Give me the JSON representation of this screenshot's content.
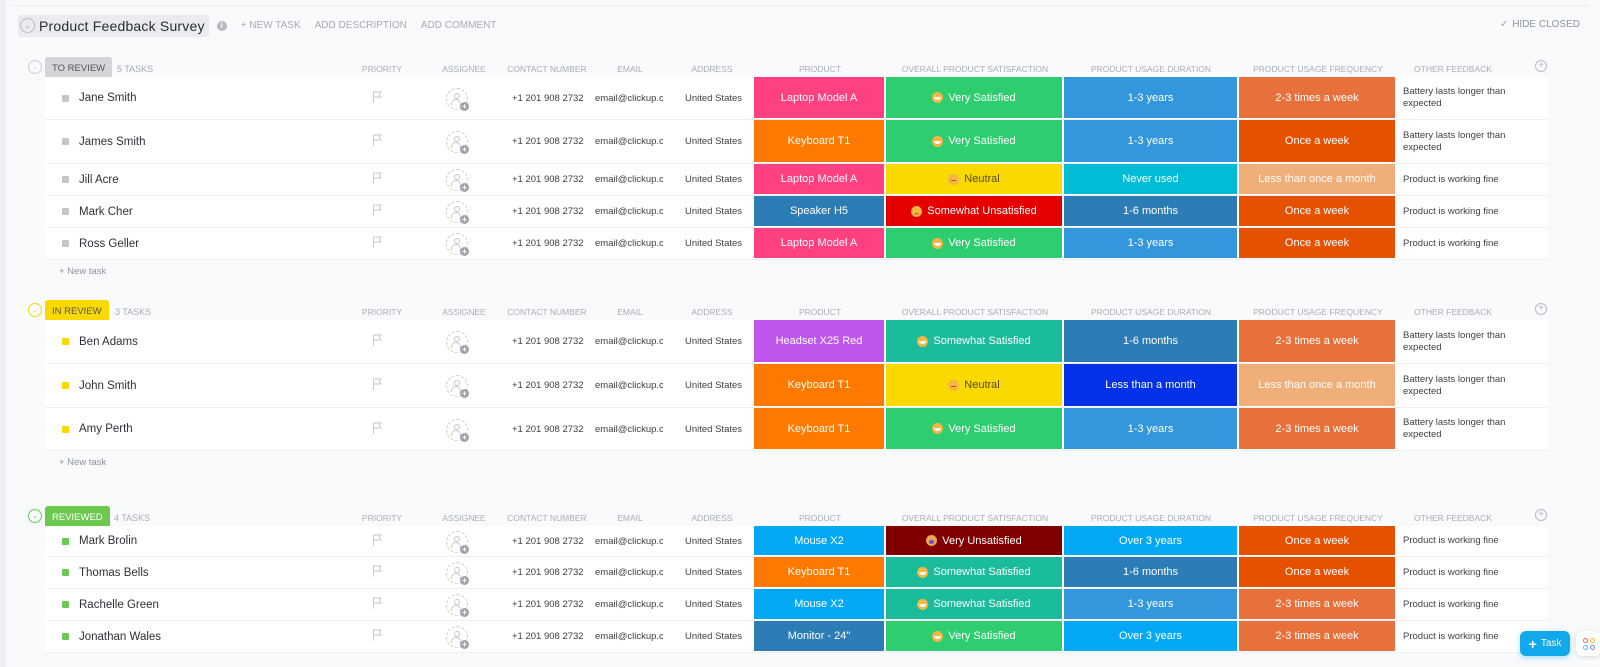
{
  "header": {
    "title": "Product Feedback Survey",
    "actions": [
      "+ NEW TASK",
      "ADD DESCRIPTION",
      "ADD COMMENT"
    ],
    "hide_closed": "HIDE CLOSED"
  },
  "columns": [
    "PRIORITY",
    "ASSIGNEE",
    "CONTACT NUMBER",
    "EMAIL",
    "ADDRESS",
    "PRODUCT",
    "OVERALL PRODUCT SATISFACTION",
    "PRODUCT USAGE DURATION",
    "PRODUCT USAGE FREQUENCY",
    "OTHER FEEDBACK"
  ],
  "new_task_label": "+ New task",
  "fab": {
    "task_label": "Task"
  },
  "colors": {
    "to_review": "#d3d5d9",
    "in_review": "#f9d900",
    "reviewed": "#6bc950",
    "product": {
      "Laptop Model A": "#ff4081",
      "Keyboard T1": "#ff7800",
      "Speaker H5": "#2c7cb5",
      "Headset X25 Red": "#bf55ec",
      "Mouse X2": "#03a9f4",
      "Monitor - 24\"": "#2c7cb5"
    },
    "satisfaction": {
      "Very Satisfied": "#2ecd6f",
      "Neutral": "#f9d900",
      "Somewhat Unsatisfied": "#e50000",
      "Somewhat Satisfied": "#1bbc9c",
      "Very Unsatisfied": "#800000"
    },
    "duration": {
      "1-3 years": "#3397dd",
      "Never used": "#00bcd4",
      "1-6 months": "#2c7cb5",
      "Less than a month": "#0231e8",
      "Over 3 years": "#03a9f4"
    },
    "frequency": {
      "2-3 times a week": "#e8703a",
      "Once a week": "#e65100",
      "Less than once a month": "#f0ae78"
    }
  },
  "groups": [
    {
      "status": "TO REVIEW",
      "count_label": "5 TASKS",
      "tasks": [
        {
          "name": "Jane Smith",
          "phone": "+1 201 908 2732",
          "email": "email@clickup.cc",
          "address": "United States",
          "product": "Laptop Model A",
          "satisfaction": "Very Satisfied",
          "duration": "1-3 years",
          "frequency": "2-3 times a week",
          "feedback": "Battery lasts longer than expected"
        },
        {
          "name": "James Smith",
          "phone": "+1 201 908 2732",
          "email": "email@clickup.cc",
          "address": "United States",
          "product": "Keyboard T1",
          "satisfaction": "Very Satisfied",
          "duration": "1-3 years",
          "frequency": "Once a week",
          "feedback": "Battery lasts longer than expected"
        },
        {
          "name": "Jill Acre",
          "phone": "+1 201 908 2732",
          "email": "email@clickup.cc",
          "address": "United States",
          "product": "Laptop Model A",
          "satisfaction": "Neutral",
          "duration": "Never used",
          "frequency": "Less than once a month",
          "feedback": "Product is working fine"
        },
        {
          "name": "Mark Cher",
          "phone": "+1 201 908 2732",
          "email": "email@clickup.cc",
          "address": "United States",
          "product": "Speaker H5",
          "satisfaction": "Somewhat Unsatisfied",
          "duration": "1-6 months",
          "frequency": "Once a week",
          "feedback": "Product is working fine"
        },
        {
          "name": "Ross Geller",
          "phone": "+1 201 908 2732",
          "email": "email@clickup.cc",
          "address": "United States",
          "product": "Laptop Model A",
          "satisfaction": "Very Satisfied",
          "duration": "1-3 years",
          "frequency": "Once a week",
          "feedback": "Product is working fine"
        }
      ]
    },
    {
      "status": "IN REVIEW",
      "count_label": "3 TASKS",
      "tasks": [
        {
          "name": "Ben Adams",
          "phone": "+1 201 908 2732",
          "email": "email@clickup.cc",
          "address": "United States",
          "product": "Headset X25 Red",
          "satisfaction": "Somewhat Satisfied",
          "duration": "1-6 months",
          "frequency": "2-3 times a week",
          "feedback": "Battery lasts longer than expected"
        },
        {
          "name": "John Smith",
          "phone": "+1 201 908 2732",
          "email": "email@clickup.cc",
          "address": "United States",
          "product": "Keyboard T1",
          "satisfaction": "Neutral",
          "duration": "Less than a month",
          "frequency": "Less than once a month",
          "feedback": "Battery lasts longer than expected"
        },
        {
          "name": "Amy Perth",
          "phone": "+1 201 908 2732",
          "email": "email@clickup.cc",
          "address": "United States",
          "product": "Keyboard T1",
          "satisfaction": "Very Satisfied",
          "duration": "1-3 years",
          "frequency": "2-3 times a week",
          "feedback": "Battery lasts longer than expected"
        }
      ]
    },
    {
      "status": "REVIEWED",
      "count_label": "4 TASKS",
      "tasks": [
        {
          "name": "Mark Brolin",
          "phone": "+1 201 908 2732",
          "email": "email@clickup.cc",
          "address": "United States",
          "product": "Mouse X2",
          "satisfaction": "Very Unsatisfied",
          "duration": "Over 3 years",
          "frequency": "Once a week",
          "feedback": "Product is working fine"
        },
        {
          "name": "Thomas Bells",
          "phone": "+1 201 908 2732",
          "email": "email@clickup.cc",
          "address": "United States",
          "product": "Keyboard T1",
          "satisfaction": "Somewhat Satisfied",
          "duration": "1-6 months",
          "frequency": "Once a week",
          "feedback": "Product is working fine"
        },
        {
          "name": "Rachelle Green",
          "phone": "+1 201 908 2732",
          "email": "email@clickup.cc",
          "address": "United States",
          "product": "Mouse X2",
          "satisfaction": "Somewhat Satisfied",
          "duration": "1-3 years",
          "frequency": "2-3 times a week",
          "feedback": "Product is working fine"
        },
        {
          "name": "Jonathan Wales",
          "phone": "+1 201 908 2732",
          "email": "email@clickup.cc",
          "address": "United States",
          "product": "Monitor - 24\"",
          "satisfaction": "Very Satisfied",
          "duration": "Over 3 years",
          "frequency": "2-3 times a week",
          "feedback": "Product is working fine"
        }
      ]
    }
  ]
}
